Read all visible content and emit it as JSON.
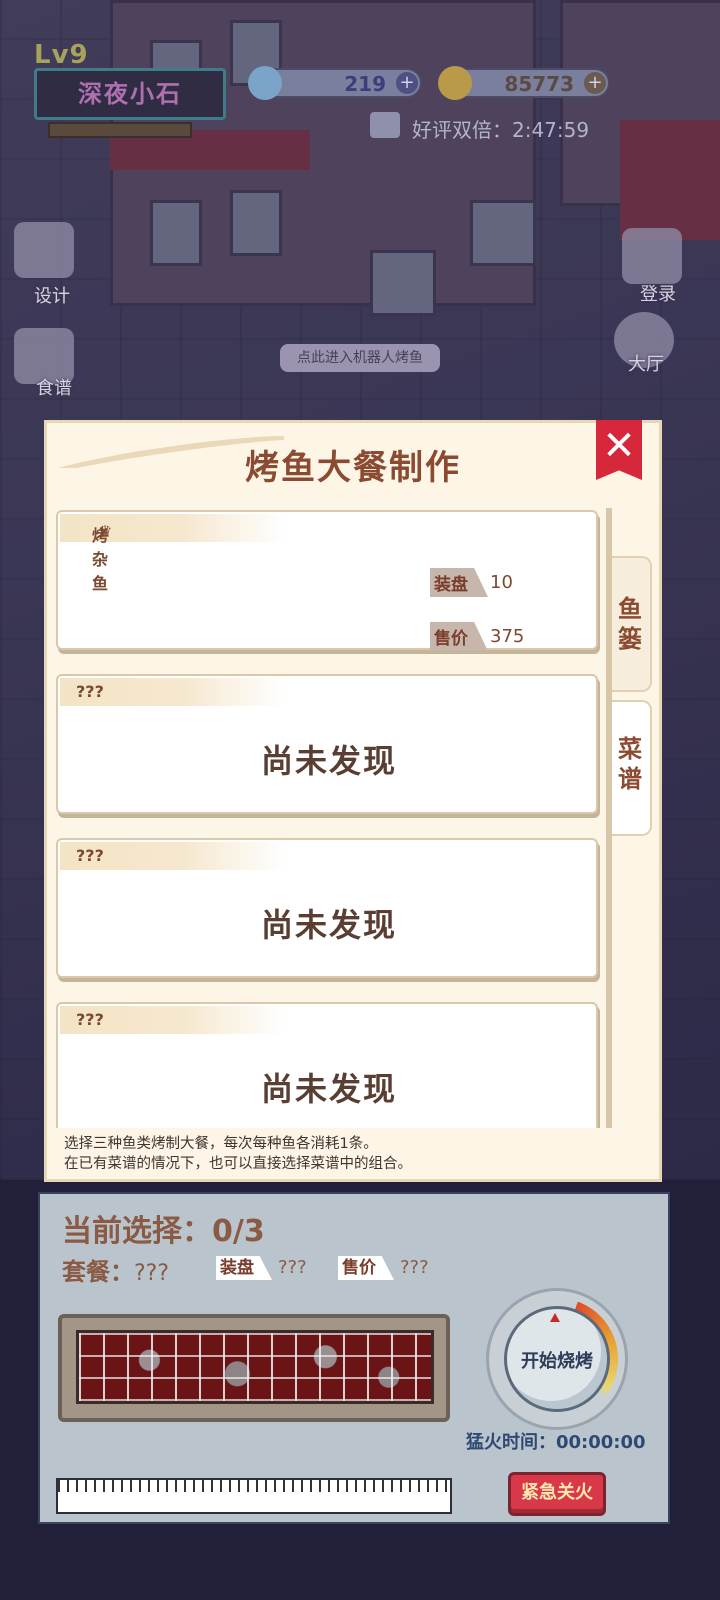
{
  "hud": {
    "level": "Lv9",
    "player_name": "深夜小石",
    "diamonds": "219",
    "coins": "85773",
    "double_timer": "好评双倍：2:47:59"
  },
  "side_menu": {
    "design": "设计",
    "recipes": "食谱",
    "signin": "登录",
    "hall": "大厅"
  },
  "scene": {
    "bubble": "点此进入机器人烤鱼"
  },
  "dialog": {
    "title": "烤鱼大餐制作",
    "close_label": "✕",
    "tabs": [
      "鱼篓",
      "菜谱"
    ],
    "cards": [
      {
        "name": "烤杂鱼",
        "plate_label": "装盘",
        "plate_value": "10",
        "price_label": "售价",
        "price_value": "375"
      },
      {
        "name": "???",
        "status": "尚未发现"
      },
      {
        "name": "???",
        "status": "尚未发现"
      },
      {
        "name": "???",
        "status": "尚未发现"
      }
    ],
    "note_line1": "选择三种鱼类烤制大餐，每次每种鱼各消耗1条。",
    "note_line2": "在已有菜谱的情况下，也可以直接选择菜谱中的组合。"
  },
  "panel": {
    "current_selection": "当前选择：0/3",
    "meal_label": "套餐：",
    "meal_value": "???",
    "plate_label": "装盘",
    "plate_value": "???",
    "price_label": "售价",
    "price_value": "???",
    "start_label": "开始烧烤",
    "fire_time": "猛火时间：00:00:00",
    "emergency_label": "紧急关火"
  },
  "colors": {
    "title": "#8b4a32",
    "close": "#d6283a",
    "panel_bg": "#bac4cc",
    "emergency": "#d83848"
  }
}
